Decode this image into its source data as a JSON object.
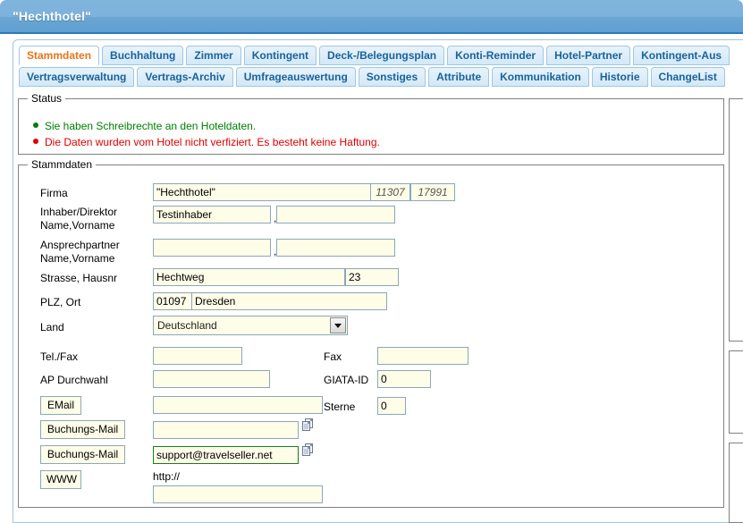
{
  "window": {
    "title": "\"Hechthotel\""
  },
  "tabs": {
    "row1": [
      {
        "label": "Stammdaten",
        "active": true
      },
      {
        "label": "Buchhaltung",
        "active": false
      },
      {
        "label": "Zimmer",
        "active": false
      },
      {
        "label": "Kontingent",
        "active": false
      },
      {
        "label": "Deck-/Belegungsplan",
        "active": false
      },
      {
        "label": "Konti-Reminder",
        "active": false
      },
      {
        "label": "Hotel-Partner",
        "active": false
      },
      {
        "label": "Kontingent-Aus",
        "active": false
      }
    ],
    "row2": [
      {
        "label": "Vertragsverwaltung",
        "active": false
      },
      {
        "label": "Vertrags-Archiv",
        "active": false
      },
      {
        "label": "Umfrageauswertung",
        "active": false
      },
      {
        "label": "Sonstiges",
        "active": false
      },
      {
        "label": "Attribute",
        "active": false
      },
      {
        "label": "Kommunikation",
        "active": false
      },
      {
        "label": "Historie",
        "active": false
      },
      {
        "label": "ChangeList",
        "active": false
      }
    ]
  },
  "status": {
    "legend": "Status",
    "ok_text": "Sie haben Schreibrechte an den Hoteldaten.",
    "err_text": "Die Daten wurden vom Hotel nicht verfiziert. Es besteht keine Haftung.",
    "ok_color": "#008000",
    "err_color": "#e00000"
  },
  "stammdaten": {
    "legend": "Stammdaten",
    "labels": {
      "firma": "Firma",
      "inhaber_l1": "Inhaber/Direktor",
      "inhaber_l2": "Name,Vorname",
      "ansprech_l1": "Ansprechpartner",
      "ansprech_l2": "Name,Vorname",
      "strasse": "Strasse, Hausnr",
      "plz_ort": "PLZ, Ort",
      "land": "Land",
      "telfax": "Tel./Fax",
      "ap_durchwahl": "AP Durchwahl",
      "fax": "Fax",
      "giata": "GIATA-ID",
      "sterne": "Sterne",
      "comma": ","
    },
    "buttons": {
      "email": "EMail",
      "buchungs_mail_1": "Buchungs-Mail",
      "buchungs_mail_2": "Buchungs-Mail",
      "www": "WWW"
    },
    "values": {
      "firma": "\"Hechthotel\"",
      "firma_id1": "11307",
      "firma_id2": "17991",
      "inhaber_name": "Testinhaber",
      "inhaber_vorname": "",
      "ansprech_name": "",
      "ansprech_vorname": "",
      "strasse": "Hechtweg",
      "hausnr": "23",
      "plz": "01097",
      "ort": "Dresden",
      "land": "Deutschland",
      "tel": "",
      "fax": "",
      "ap_durchwahl": "",
      "giata": "0",
      "email": "",
      "sterne": "0",
      "buchungs_mail_1": "",
      "buchungs_mail_2": "support@travelseller.net",
      "www_protocol": "http://",
      "www": ""
    },
    "icons": {
      "copy_1": "copy-icon",
      "copy_2": "copy-icon",
      "dropdown": "chevron-down-icon"
    }
  }
}
